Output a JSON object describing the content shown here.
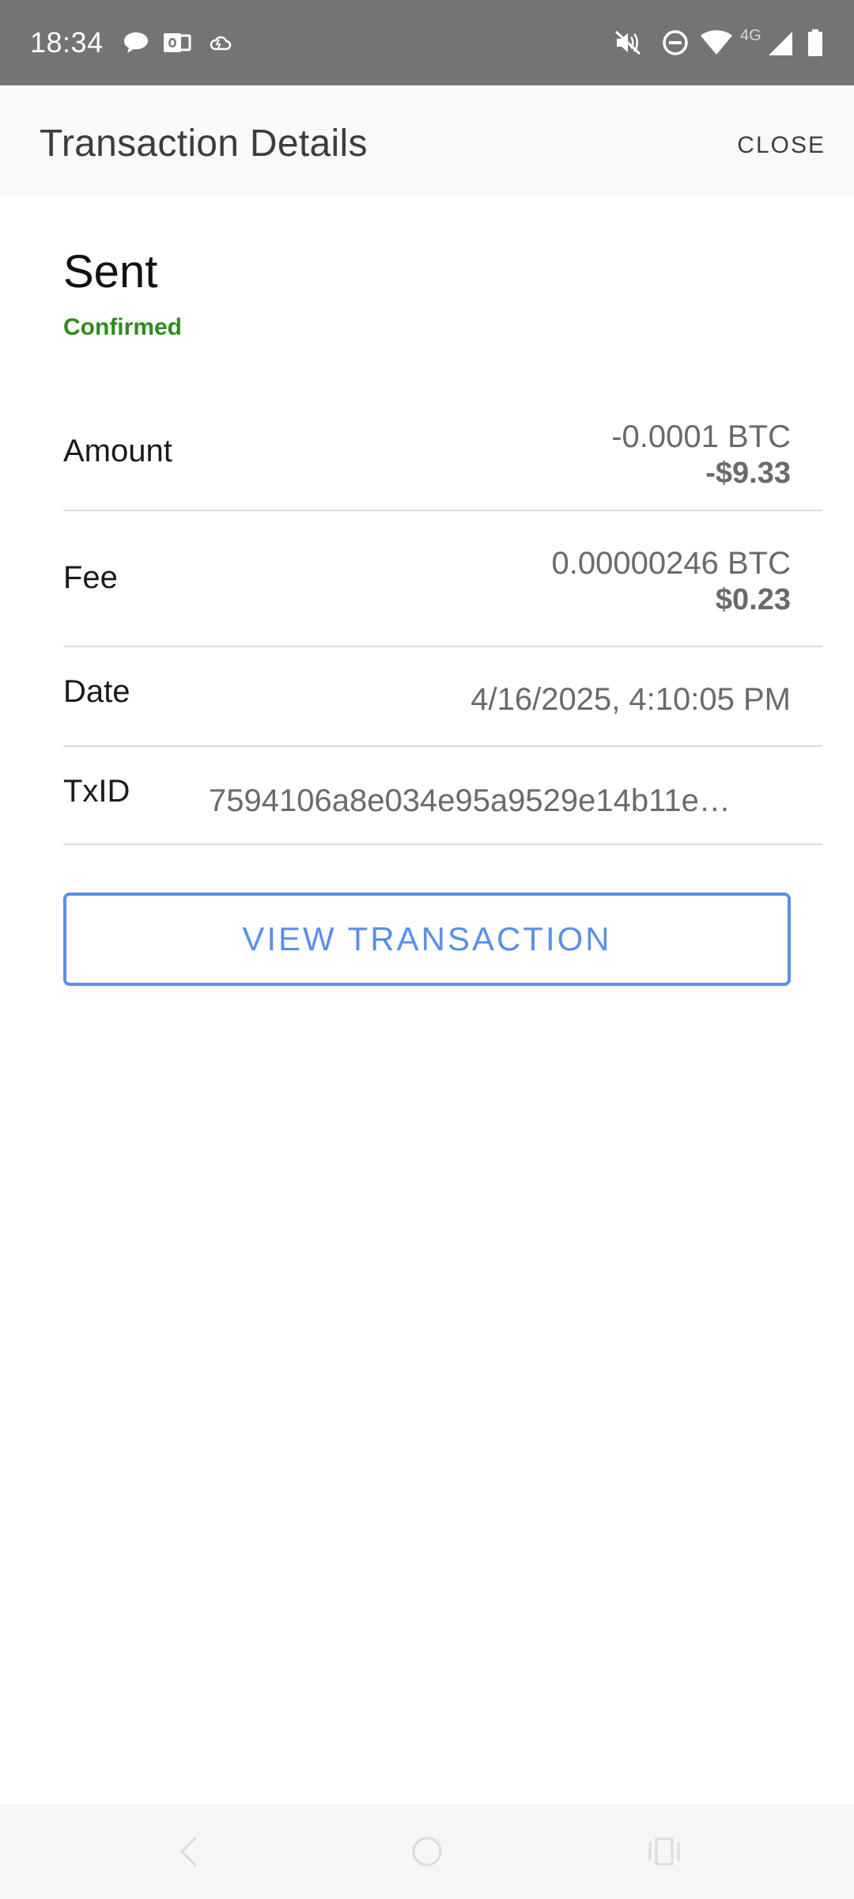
{
  "status_bar": {
    "time": "18:34",
    "network_label": "4G",
    "icons": [
      "chat-icon",
      "outlook-icon",
      "cloud-icon",
      "mute-icon",
      "dnd-icon",
      "wifi-icon",
      "signal-icon",
      "battery-icon"
    ]
  },
  "app_bar": {
    "title": "Transaction Details",
    "close_label": "CLOSE"
  },
  "transaction": {
    "type": "Sent",
    "status": "Confirmed",
    "status_color": "#2e8b1e",
    "rows": {
      "amount": {
        "label": "Amount",
        "value": "-0.0001 BTC",
        "fiat": "-$9.33"
      },
      "fee": {
        "label": "Fee",
        "value": "0.00000246 BTC",
        "fiat": "$0.23"
      },
      "date": {
        "label": "Date",
        "value": "4/16/2025, 4:10:05 PM"
      },
      "txid": {
        "label": "TxID",
        "value": "7594106a8e034e95a9529e14b11e…"
      }
    }
  },
  "actions": {
    "view_transaction_label": "VIEW TRANSACTION",
    "accent_color": "#5b8fe8"
  },
  "nav_bar": {
    "icons": [
      "back-icon",
      "home-icon",
      "recents-icon"
    ]
  }
}
